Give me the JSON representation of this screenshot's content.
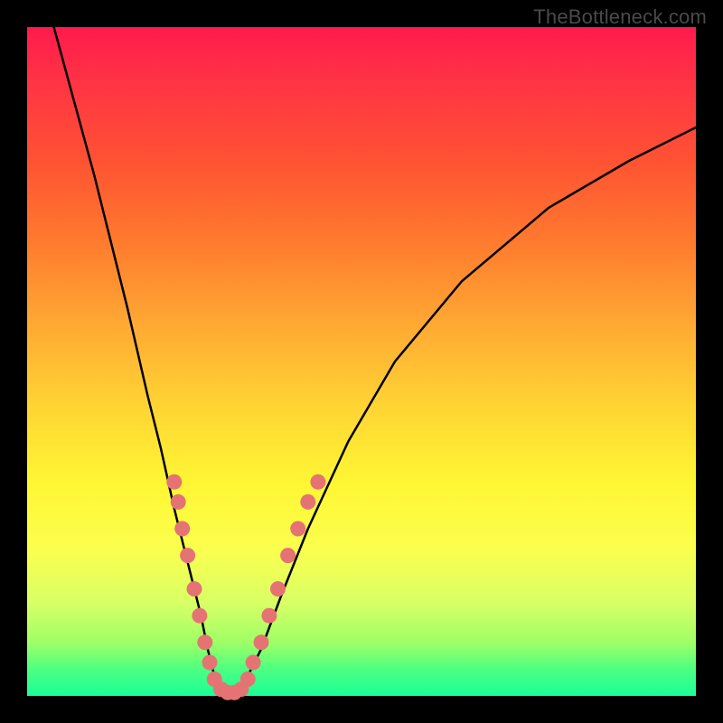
{
  "watermark": {
    "text": "TheBottleneck.com"
  },
  "chart_data": {
    "type": "line",
    "title": "",
    "xlabel": "",
    "ylabel": "",
    "xlim": [
      0,
      100
    ],
    "ylim": [
      0,
      100
    ],
    "series": [
      {
        "name": "bottleneck-curve",
        "x": [
          4,
          10,
          15,
          18,
          20,
          22,
          24,
          26,
          27,
          28,
          29,
          30,
          31,
          32,
          33,
          35,
          38,
          42,
          48,
          55,
          65,
          78,
          90,
          100
        ],
        "y": [
          100,
          78,
          58,
          45,
          37,
          28,
          20,
          12,
          7,
          3,
          1,
          0,
          0,
          1,
          3,
          7,
          15,
          25,
          38,
          50,
          62,
          73,
          80,
          85
        ]
      }
    ],
    "highlighted_points": {
      "name": "dots",
      "points": [
        {
          "x": 22.0,
          "y": 32
        },
        {
          "x": 22.6,
          "y": 29
        },
        {
          "x": 23.2,
          "y": 25
        },
        {
          "x": 24.0,
          "y": 21
        },
        {
          "x": 25.0,
          "y": 16
        },
        {
          "x": 25.8,
          "y": 12
        },
        {
          "x": 26.6,
          "y": 8
        },
        {
          "x": 27.3,
          "y": 5
        },
        {
          "x": 28.0,
          "y": 2.5
        },
        {
          "x": 29.0,
          "y": 1
        },
        {
          "x": 30.0,
          "y": 0.5
        },
        {
          "x": 31.0,
          "y": 0.5
        },
        {
          "x": 32.0,
          "y": 1
        },
        {
          "x": 33.0,
          "y": 2.5
        },
        {
          "x": 33.8,
          "y": 5
        },
        {
          "x": 35.0,
          "y": 8
        },
        {
          "x": 36.2,
          "y": 12
        },
        {
          "x": 37.5,
          "y": 16
        },
        {
          "x": 39.0,
          "y": 21
        },
        {
          "x": 40.5,
          "y": 25
        },
        {
          "x": 42.0,
          "y": 29
        },
        {
          "x": 43.5,
          "y": 32
        }
      ]
    },
    "colors": {
      "curve": "#000000",
      "dots": "#e57373",
      "background_top": "#ff1a4d",
      "background_bottom": "#1aff99"
    }
  }
}
